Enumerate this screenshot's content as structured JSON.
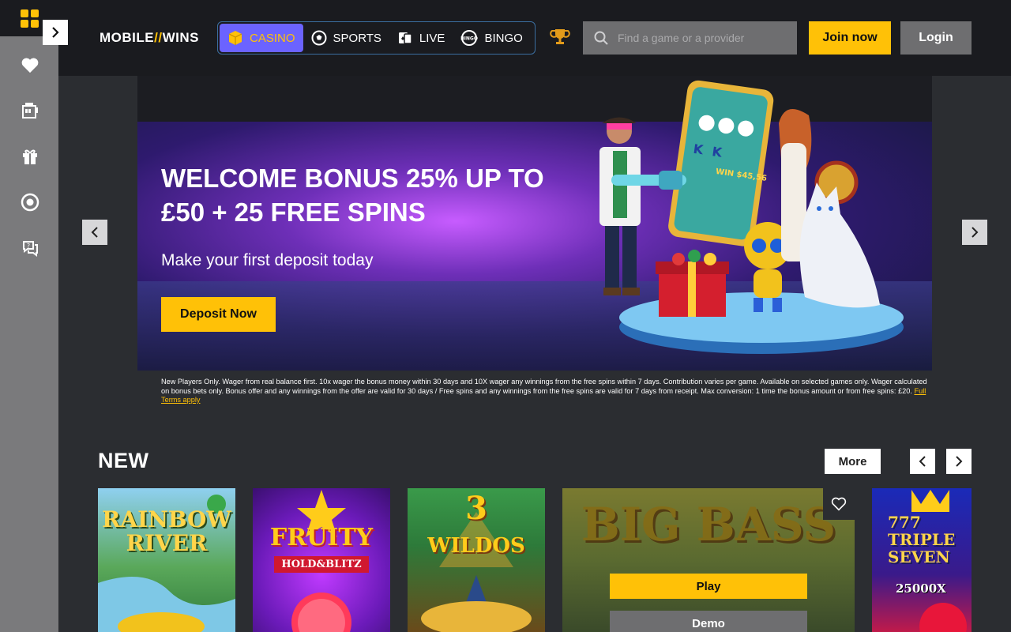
{
  "brand": {
    "logo_left": "MOBILE",
    "logo_slash": "//",
    "logo_right": "WINS"
  },
  "colors": {
    "accent": "#ffc107",
    "active_tab": "#6b63ff",
    "header_bg": "#1a1b1f",
    "page_bg": "#2b2d31",
    "sidebar_bg": "#7a7a7c"
  },
  "sidebar": {
    "icons": [
      "grid-icon",
      "heart-icon",
      "slot-machine-icon",
      "gift-icon",
      "chip-icon",
      "help-chat-icon"
    ]
  },
  "nav": {
    "tabs": [
      {
        "label": "CASINO",
        "icon": "casino-cube-icon",
        "active": true
      },
      {
        "label": "SPORTS",
        "icon": "football-icon",
        "active": false
      },
      {
        "label": "LIVE",
        "icon": "live-cards-icon",
        "active": false
      },
      {
        "label": "BINGO",
        "icon": "bingo-icon",
        "active": false
      }
    ]
  },
  "search": {
    "placeholder": "Find a game or a provider"
  },
  "header": {
    "join_label": "Join now",
    "login_label": "Login"
  },
  "hero": {
    "title": "WELCOME BONUS 25% UP TO £50 + 25 FREE SPINS",
    "subtitle": "Make your first deposit today",
    "cta": "Deposit Now",
    "phone_win": "WIN $45,56"
  },
  "terms": {
    "text": "New Players Only. Wager from real balance first. 10x wager the bonus money within 30 days and 10X wager any winnings from the free spins within 7 days. Contribution varies per game. Available on selected games only. Wager calculated on bonus bets only. Bonus offer and any winnings from the offer are valid for 30 days / Free spins and any winnings from the free spins are valid for 7 days from receipt. Max conversion: 1 time the bonus amount or from free spins: £20.",
    "link": "Full Terms apply"
  },
  "new_section": {
    "title": "NEW",
    "more_label": "More",
    "games": [
      {
        "title": "RAINBOW RIVER"
      },
      {
        "title": "FRUITY",
        "subtitle": "HOLD&BLITZ"
      },
      {
        "title": "3",
        "subtitle": "WILDOS"
      },
      {
        "title": "BIG BASS",
        "play": "Play",
        "demo": "Demo"
      },
      {
        "title": "777 TRIPLE SEVEN",
        "subtitle": "25000X"
      }
    ]
  }
}
